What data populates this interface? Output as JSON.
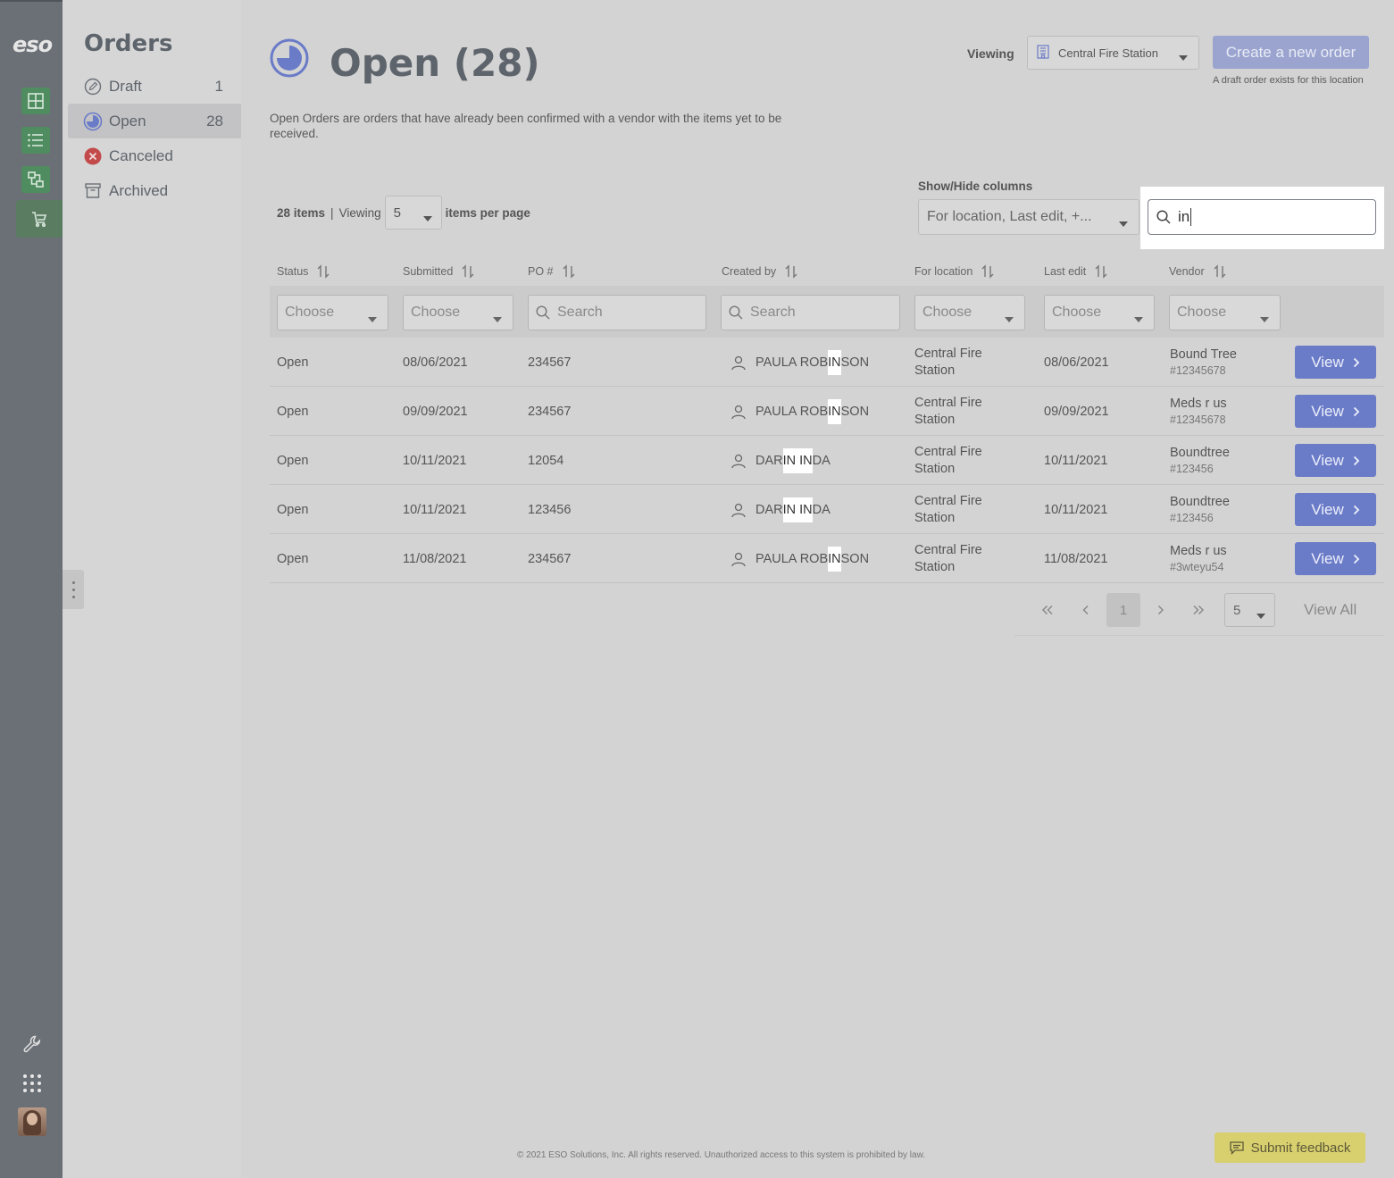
{
  "app": {
    "logo_text": "eso",
    "accent": "#6a7bc8",
    "nav_green": "#4f8c5f"
  },
  "rail": {
    "items": [
      {
        "icon": "grid-plus-icon"
      },
      {
        "icon": "list-icon"
      },
      {
        "icon": "flow-icon"
      },
      {
        "icon": "cart-icon",
        "active": true
      }
    ],
    "bottom": [
      {
        "icon": "wrench-icon"
      },
      {
        "icon": "apps-grid-icon"
      },
      {
        "icon": "avatar"
      }
    ]
  },
  "subnav": {
    "title": "Orders",
    "items": [
      {
        "label": "Draft",
        "count": "1",
        "icon": "pencil-circle-icon"
      },
      {
        "label": "Open",
        "count": "28",
        "icon": "pie-clock-icon",
        "active": true
      },
      {
        "label": "Canceled",
        "count": "",
        "icon": "cancel-circle-icon"
      },
      {
        "label": "Archived",
        "count": "",
        "icon": "archive-box-icon"
      }
    ]
  },
  "header": {
    "title": "Open (28)",
    "viewing_label": "Viewing",
    "location": "Central Fire Station",
    "create_label": "Create a new order",
    "draft_note": "A draft order exists for this location",
    "description": "Open Orders are orders that have already been confirmed with a vendor with the items yet to be received."
  },
  "toolbar": {
    "items_count": "28 items",
    "viewing": "Viewing",
    "per_page": "5",
    "per_page_suffix": "items per page",
    "show_hide_label": "Show/Hide columns",
    "show_hide_value": "For location, Last edit, +...",
    "search_value": "in"
  },
  "table": {
    "columns": [
      "Status",
      "Submitted",
      "PO #",
      "Created by",
      "For location",
      "Last edit",
      "Vendor"
    ],
    "filters": {
      "choose": "Choose",
      "search": "Search"
    },
    "rows": [
      {
        "status": "Open",
        "submitted": "08/06/2021",
        "po": "234567",
        "name_pre": "PAULA ROB",
        "name_hl": "IN",
        "name_post": "SON",
        "location_1": "Central Fire",
        "location_2": "Station",
        "last_edit": "08/06/2021",
        "vendor": "Bound Tree",
        "vendor_id": "#12345678",
        "view": "View"
      },
      {
        "status": "Open",
        "submitted": "09/09/2021",
        "po": "234567",
        "name_pre": "PAULA ROB",
        "name_hl": "IN",
        "name_post": "SON",
        "location_1": "Central Fire",
        "location_2": "Station",
        "last_edit": "09/09/2021",
        "vendor": "Meds r us",
        "vendor_id": "#12345678",
        "view": "View"
      },
      {
        "status": "Open",
        "submitted": "10/11/2021",
        "po": "12054",
        "name_pre": "DAR",
        "name_hl": "IN IN",
        "name_post": "DA",
        "location_1": "Central Fire",
        "location_2": "Station",
        "last_edit": "10/11/2021",
        "vendor": "Boundtree",
        "vendor_id": "#123456",
        "view": "View"
      },
      {
        "status": "Open",
        "submitted": "10/11/2021",
        "po": "123456",
        "name_pre": "DAR",
        "name_hl": "IN IN",
        "name_post": "DA",
        "location_1": "Central Fire",
        "location_2": "Station",
        "last_edit": "10/11/2021",
        "vendor": "Boundtree",
        "vendor_id": "#123456",
        "view": "View"
      },
      {
        "status": "Open",
        "submitted": "11/08/2021",
        "po": "234567",
        "name_pre": "PAULA ROB",
        "name_hl": "IN",
        "name_post": "SON",
        "location_1": "Central Fire",
        "location_2": "Station",
        "last_edit": "11/08/2021",
        "vendor": "Meds r us",
        "vendor_id": "#3wteyu54",
        "view": "View"
      }
    ]
  },
  "pager": {
    "current": "1",
    "page_size": "5",
    "view_all": "View All"
  },
  "footer": {
    "copyright": "© 2021 ESO Solutions, Inc. All rights reserved. Unauthorized access to this system is prohibited by law.",
    "feedback": "Submit feedback"
  }
}
